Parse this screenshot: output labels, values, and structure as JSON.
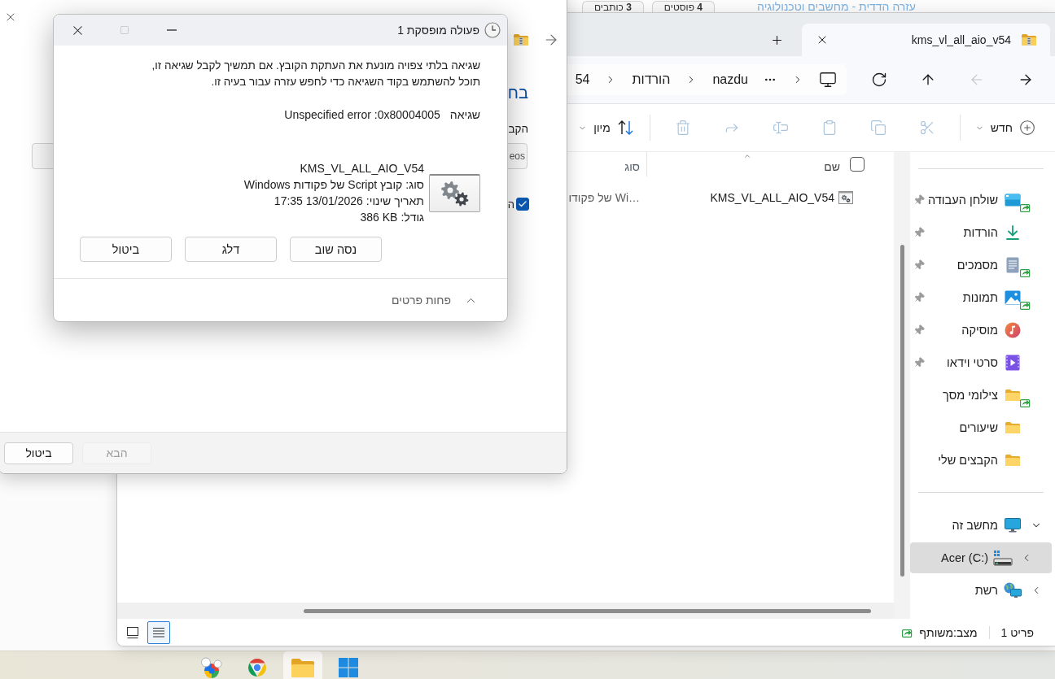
{
  "web_page": {
    "link": "עזרה הדדית - מחשבים וטכנולוגיה",
    "badges": [
      "**4** פוסטים",
      "**3** כותבים"
    ]
  },
  "explorer": {
    "tabs": [
      {
        "title": "kms_vl_all_aio_v54",
        "selected": true
      }
    ],
    "nav_buttons": [
      {
        "kind": "back",
        "disabled": false
      },
      {
        "kind": "forward",
        "disabled": true
      },
      {
        "kind": "up",
        "disabled": false
      },
      {
        "kind": "refresh",
        "disabled": false
      }
    ],
    "breadcrumbs": [
      "nazdu",
      "הורדות",
      "54"
    ],
    "toolbar": {
      "new_label": "חדש",
      "actions": [
        {
          "kind": "cut",
          "disabled": true
        },
        {
          "kind": "copy",
          "disabled": true
        },
        {
          "kind": "paste",
          "disabled": true
        },
        {
          "kind": "rename",
          "disabled": true
        },
        {
          "kind": "share",
          "disabled": true
        },
        {
          "kind": "delete",
          "disabled": true
        }
      ],
      "sort_label": "מיון"
    },
    "select_all": {
      "checked": false
    },
    "columns": [
      {
        "label": "שם",
        "sorted": true
      },
      {
        "label": "סוג",
        "sorted": false
      }
    ],
    "files": [
      {
        "name": "KMS_VL_ALL_AIO_V54",
        "type": "…Wi של פקודו",
        "selected": false
      }
    ],
    "quick_access": [
      {
        "label": "שולחן העבודה",
        "kind": "desktop",
        "shared": true,
        "pinned": true
      },
      {
        "label": "הורדות",
        "kind": "downloads",
        "shared": false,
        "pinned": true
      },
      {
        "label": "מסמכים",
        "kind": "documents",
        "shared": true,
        "pinned": true
      },
      {
        "label": "תמונות",
        "kind": "pictures",
        "shared": true,
        "pinned": true
      },
      {
        "label": "מוסיקה",
        "kind": "music",
        "shared": false,
        "pinned": true
      },
      {
        "label": "סרטי וידאו",
        "kind": "videos",
        "shared": false,
        "pinned": true
      },
      {
        "label": "צילומי מסך",
        "kind": "folder",
        "shared": true,
        "pinned": false
      },
      {
        "label": "שיעורים",
        "kind": "folder",
        "shared": false,
        "pinned": false
      },
      {
        "label": "הקבצים שלי",
        "kind": "folder",
        "shared": false,
        "pinned": false
      }
    ],
    "tree": [
      {
        "label": "מחשב זה",
        "kind": "computer",
        "expanded": true,
        "selected": false,
        "children": [
          {
            "label": "Acer (C:)",
            "kind": "drive",
            "expanded": false,
            "selected": true
          }
        ]
      },
      {
        "label": "רשת",
        "kind": "network",
        "expanded": false,
        "selected": false
      }
    ],
    "status": {
      "count": "פריט 1",
      "state": "מצב:משותף"
    },
    "views": [
      {
        "kind": "tiles",
        "selected": false
      },
      {
        "kind": "details",
        "selected": true
      }
    ]
  },
  "copy_dialog": {
    "heading": "בח",
    "label": "הקב",
    "field_value": "eos",
    "option": {
      "label": "ה",
      "checked": true
    },
    "buttons": [
      {
        "label": "הבא",
        "disabled": true
      },
      {
        "label": "ביטול",
        "disabled": false
      }
    ]
  },
  "error_dialog": {
    "title": "פעולה מופסקת 1",
    "message": "שגיאה בלתי צפויה מונעת את העתקת הקובץ. אם תמשיך לקבל שגיאה זו, תוכל להשתמש בקוד השגיאה כדי לחפש עזרה עבור בעיה זו.",
    "error": {
      "label": "שגיאה",
      "value": "Unspecified error :0x80004005"
    },
    "file": {
      "name": "KMS_VL_ALL_AIO_V54",
      "details": [
        {
          "label": "סוג:",
          "value": "קובץ Script של פקודות Windows"
        },
        {
          "label": "תאריך שינוי:",
          "value": "17:35 13/01/2026"
        },
        {
          "label": "גודל:",
          "value": "386 KB"
        }
      ]
    },
    "buttons": [
      "נסה שוב",
      "דלג",
      "ביטול"
    ],
    "details_toggle": {
      "label": "פחות פרטים",
      "expanded": true
    }
  },
  "taskbar": {
    "apps": [
      {
        "kind": "circles",
        "active": false
      },
      {
        "kind": "browser",
        "active": false
      },
      {
        "kind": "folder",
        "active": true
      },
      {
        "kind": "start",
        "active": false
      }
    ]
  }
}
